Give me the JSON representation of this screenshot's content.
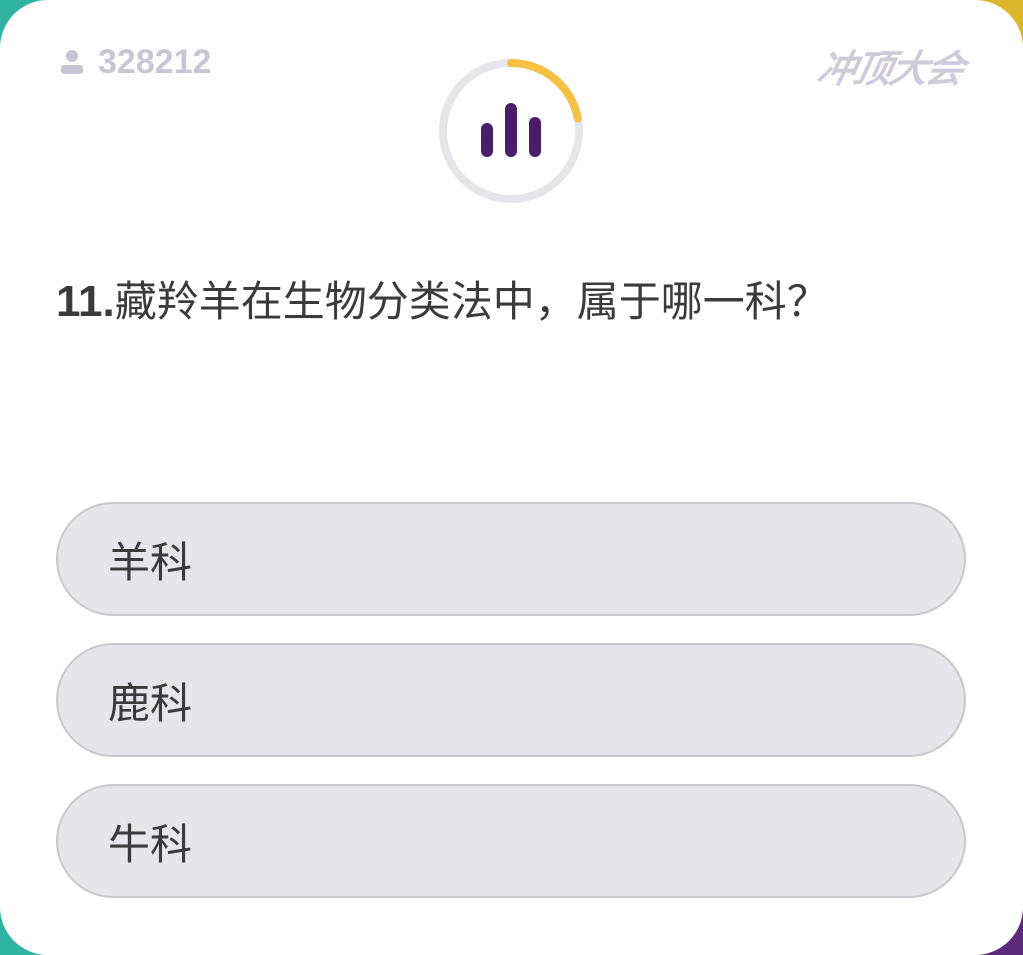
{
  "header": {
    "viewer_count": "328212",
    "brand": "冲顶大会"
  },
  "timer": {
    "progress_fraction": 0.22,
    "colors": {
      "track": "#e6e5e9",
      "progress": "#f6c043",
      "icon": "#4a1d6b"
    }
  },
  "question": {
    "number": "11.",
    "text": "藏羚羊在生物分类法中，属于哪一科？"
  },
  "options": [
    {
      "label": "羊科"
    },
    {
      "label": "鹿科"
    },
    {
      "label": "牛科"
    }
  ],
  "icons": {
    "viewer": "person-icon",
    "timer": "bar-chart-icon"
  }
}
